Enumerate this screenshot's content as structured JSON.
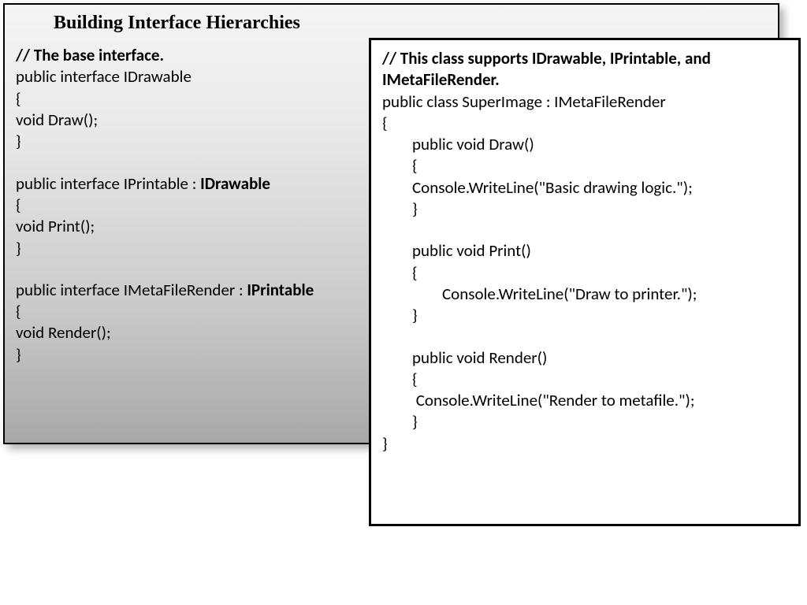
{
  "title": "Building Interface Hierarchies",
  "left": {
    "comment1": "// The base interface.",
    "l1": "public interface IDrawable",
    "l2": "{",
    "l3": "void Draw();",
    "l4": "}",
    "l5a": "public interface IPrintable : ",
    "l5b": "IDrawable",
    "l6": "{",
    "l7": "void Print();",
    "l8": "}",
    "l9a": "public interface IMetaFileRender : ",
    "l9b": "IPrintable",
    "l10": "{",
    "l11": "void Render();",
    "l12": "}"
  },
  "right": {
    "comment": "// This class supports IDrawable, IPrintable, and IMetaFileRender.",
    "r1": "public class SuperImage : IMetaFileRender",
    "r2": "{",
    "r3": "        public void Draw()",
    "r4": "        {",
    "r5": "        Console.WriteLine(\"Basic drawing logic.\");",
    "r6": "        }",
    "r7": "        public void Print()",
    "r8": "        {",
    "r9": "                Console.WriteLine(\"Draw to printer.\");",
    "r10": "        }",
    "r11": "        public void Render()",
    "r12": "        {",
    "r13": "         Console.WriteLine(\"Render to metafile.\");",
    "r14": "        }",
    "r15": "}"
  }
}
